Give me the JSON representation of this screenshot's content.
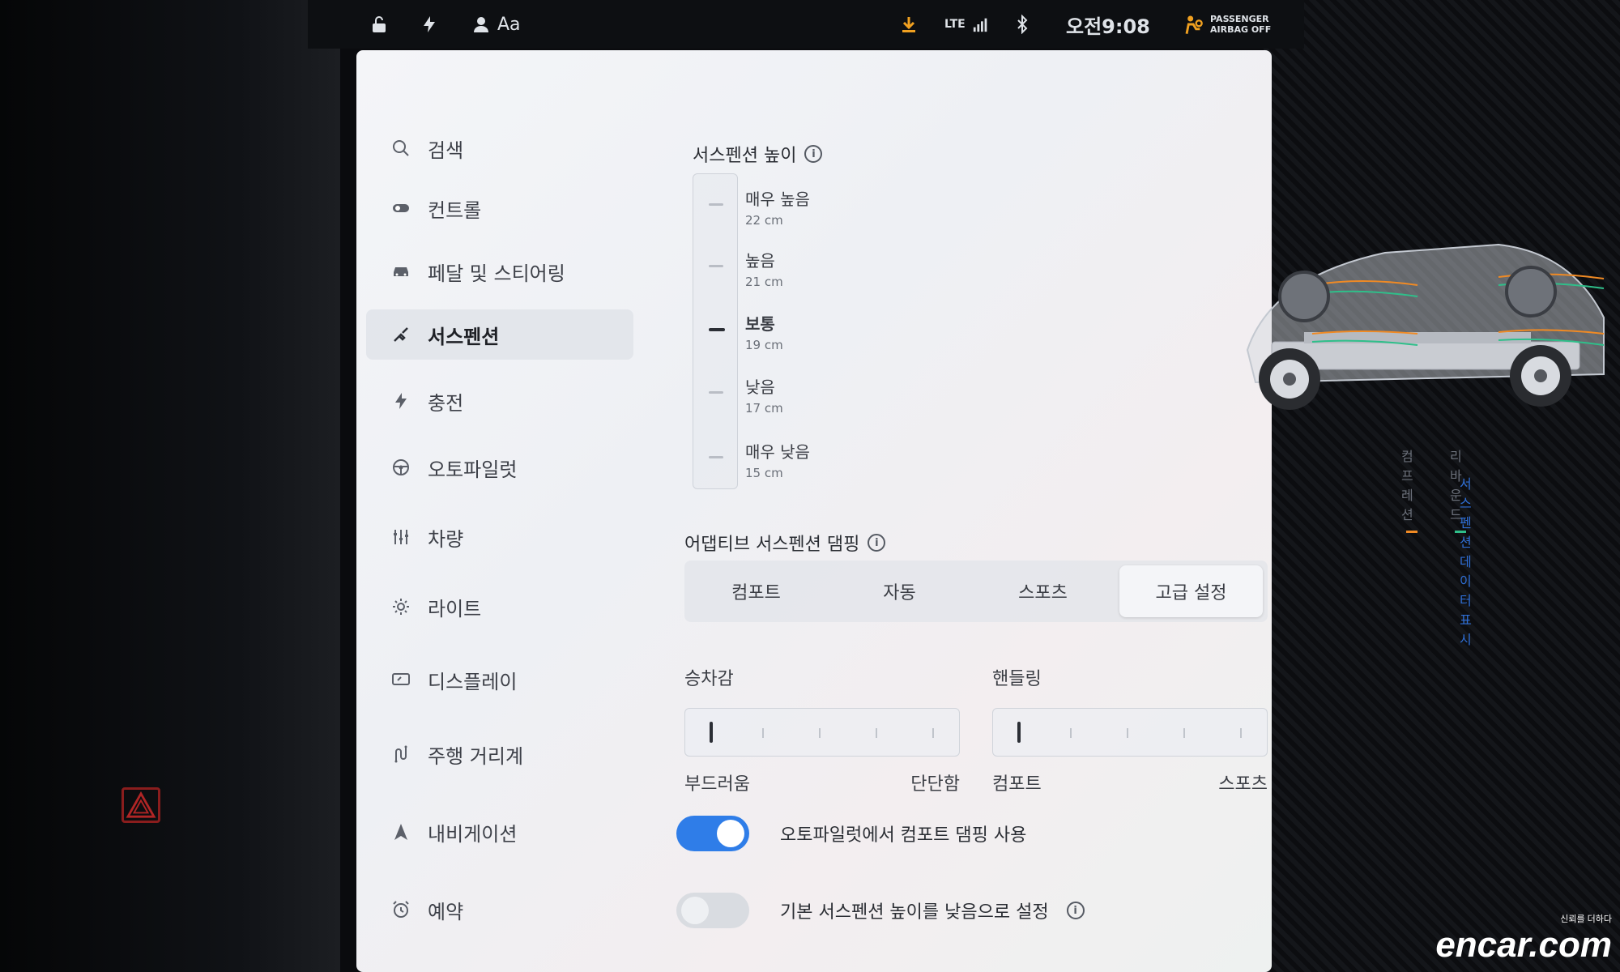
{
  "status_bar": {
    "profile_label": "Aa",
    "network": "LTE",
    "time": "오전9:08",
    "airbag_line1": "PASSENGER",
    "airbag_line2": "AIRBAG OFF"
  },
  "sidebar": {
    "items": [
      {
        "label": "검색",
        "icon": "search-icon"
      },
      {
        "label": "컨트롤",
        "icon": "toggle-icon"
      },
      {
        "label": "페달 및 스티어링",
        "icon": "car-icon"
      },
      {
        "label": "서스펜션",
        "icon": "suspension-icon",
        "active": true
      },
      {
        "label": "충전",
        "icon": "bolt-icon"
      },
      {
        "label": "오토파일럿",
        "icon": "steering-wheel-icon"
      },
      {
        "label": "차량",
        "icon": "sliders-icon"
      },
      {
        "label": "라이트",
        "icon": "sun-icon"
      },
      {
        "label": "디스플레이",
        "icon": "display-icon"
      },
      {
        "label": "주행 거리계",
        "icon": "trip-icon"
      },
      {
        "label": "내비게이션",
        "icon": "navigation-arrow-icon"
      },
      {
        "label": "예약",
        "icon": "alarm-icon"
      }
    ]
  },
  "suspension_height": {
    "title": "서스펜션 높이",
    "options": [
      {
        "label": "매우 높음",
        "value": "22 cm"
      },
      {
        "label": "높음",
        "value": "21 cm"
      },
      {
        "label": "보통",
        "value": "19 cm",
        "selected": true
      },
      {
        "label": "낮음",
        "value": "17 cm"
      },
      {
        "label": "매우 낮음",
        "value": "15 cm"
      }
    ]
  },
  "legend": {
    "compression": "컴프레션",
    "rebound": "리바운드",
    "compression_color": "#f08a24",
    "rebound_color": "#2fbf8a",
    "show_data_link": "서스펜션 데이터 표시"
  },
  "damping": {
    "title": "어댑티브 서스펜션 댐핑",
    "options": [
      "컴포트",
      "자동",
      "스포츠",
      "고급 설정"
    ],
    "active_index": 3
  },
  "ride_slider": {
    "title": "승차감",
    "min_label": "부드러움",
    "max_label": "단단함",
    "level": 0
  },
  "handling_slider": {
    "title": "핸들링",
    "min_label": "컴포트",
    "max_label": "스포츠",
    "level": 0
  },
  "toggles": [
    {
      "label": "오토파일럿에서 컴포트 댐핑 사용",
      "on": true
    },
    {
      "label": "기본 서스펜션 높이를 낮음으로 설정",
      "on": false
    }
  ],
  "watermark": {
    "tagline": "신뢰를 더하다",
    "brand": "encar.com"
  }
}
